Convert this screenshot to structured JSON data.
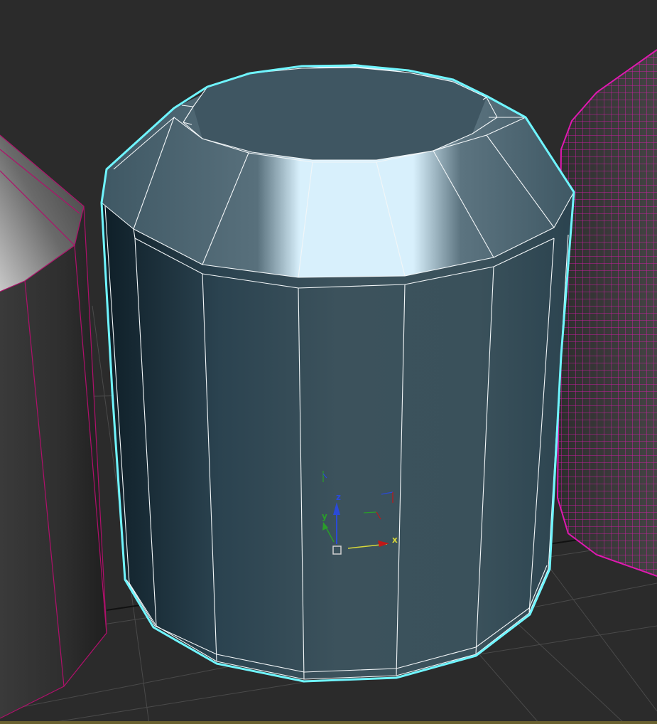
{
  "viewport": {
    "background": "#2b2b2b",
    "grid_color": "#4a4a4a"
  },
  "objects": {
    "selected": {
      "selection_outline_color": "#6ff5ff",
      "wire_color": "#ffffff",
      "base_color": "#38505c"
    },
    "left_object": {
      "wire_color": "#b0106b"
    },
    "right_object": {
      "wire_color": "#e018b0"
    }
  },
  "gizmo": {
    "x_label": "x",
    "y_label": "y",
    "z_label": "z",
    "x_color": "#d8d83a",
    "y_color": "#2a9c2a",
    "z_color": "#2a4ad8"
  },
  "bottom_border_color": "#6a6230"
}
